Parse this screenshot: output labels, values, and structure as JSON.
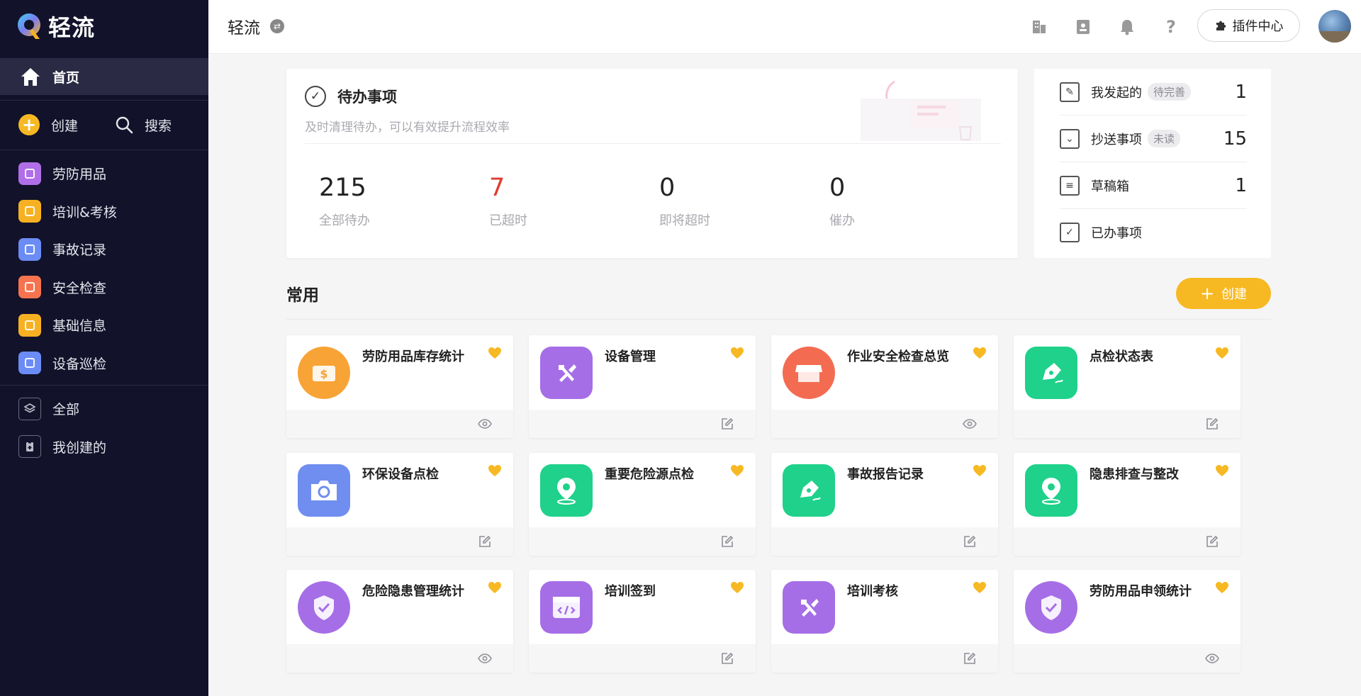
{
  "sidebar": {
    "logo_text": "轻流",
    "home_label": "首页",
    "create_label": "创建",
    "search_label": "搜索",
    "apps": [
      {
        "label": "劳防用品",
        "color": "#b06ee8"
      },
      {
        "label": "培训&考核",
        "color": "#f6b123"
      },
      {
        "label": "事故记录",
        "color": "#6b8cf5"
      },
      {
        "label": "安全检查",
        "color": "#f5744f"
      },
      {
        "label": "基础信息",
        "color": "#f6b123"
      },
      {
        "label": "设备巡检",
        "color": "#6b8cf5"
      }
    ],
    "all_label": "全部",
    "mine_label": "我创建的"
  },
  "header": {
    "title": "轻流",
    "plugin_label": "插件中心"
  },
  "todo": {
    "title": "待办事项",
    "subtitle": "及时清理待办，可以有效提升流程效率",
    "stats": [
      {
        "value": "215",
        "label": "全部待办"
      },
      {
        "value": "7",
        "label": "已超时"
      },
      {
        "value": "0",
        "label": "即将超时"
      },
      {
        "value": "0",
        "label": "催办"
      }
    ]
  },
  "right_panel": {
    "rows": [
      {
        "label": "我发起的",
        "badge": "待完善",
        "count": "1"
      },
      {
        "label": "抄送事项",
        "badge": "未读",
        "count": "15"
      },
      {
        "label": "草稿箱",
        "badge": "",
        "count": "1"
      },
      {
        "label": "已办事项",
        "badge": "",
        "count": ""
      }
    ]
  },
  "common": {
    "title": "常用",
    "create_label": "创建",
    "cards": [
      {
        "name": "劳防用品库存统计",
        "icon": "money-icon",
        "color": "#f8a336",
        "shape": "circle",
        "foot": "eye-icon"
      },
      {
        "name": "设备管理",
        "icon": "tools-icon",
        "color": "#a56ee6",
        "shape": "rsq",
        "foot": "edit-icon"
      },
      {
        "name": "作业安全检查总览",
        "icon": "store-icon",
        "color": "#f36c52",
        "shape": "circle",
        "foot": "eye-icon"
      },
      {
        "name": "点检状态表",
        "icon": "pen-icon",
        "color": "#1fd18a",
        "shape": "rsq",
        "foot": "edit-icon"
      },
      {
        "name": "环保设备点检",
        "icon": "camera-icon",
        "color": "#6f8ef0",
        "shape": "rsq",
        "foot": "edit-icon"
      },
      {
        "name": "重要危险源点检",
        "icon": "location-icon",
        "color": "#1fd18a",
        "shape": "rsq",
        "foot": "edit-icon"
      },
      {
        "name": "事故报告记录",
        "icon": "pen-icon",
        "color": "#1fd18a",
        "shape": "rsq",
        "foot": "edit-icon"
      },
      {
        "name": "隐患排查与整改",
        "icon": "location-icon",
        "color": "#1fd18a",
        "shape": "rsq",
        "foot": "edit-icon"
      },
      {
        "name": "危险隐患管理统计",
        "icon": "shield-icon",
        "color": "#a56ee6",
        "shape": "circle",
        "foot": "eye-icon"
      },
      {
        "name": "培训签到",
        "icon": "code-icon",
        "color": "#a56ee6",
        "shape": "rsq",
        "foot": "edit-icon"
      },
      {
        "name": "培训考核",
        "icon": "tools-icon",
        "color": "#a56ee6",
        "shape": "rsq",
        "foot": "edit-icon"
      },
      {
        "name": "劳防用品申领统计",
        "icon": "shield-icon",
        "color": "#a56ee6",
        "shape": "circle",
        "foot": "eye-icon"
      }
    ]
  }
}
